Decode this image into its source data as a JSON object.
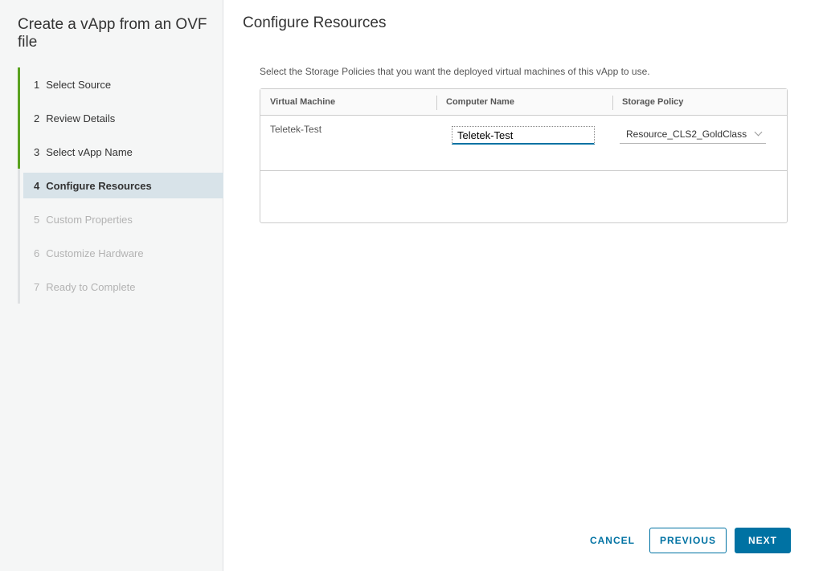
{
  "wizard": {
    "title": "Create a vApp from an OVF file",
    "steps": [
      {
        "num": "1",
        "label": "Select Source",
        "state": "done"
      },
      {
        "num": "2",
        "label": "Review Details",
        "state": "done"
      },
      {
        "num": "3",
        "label": "Select vApp Name",
        "state": "done"
      },
      {
        "num": "4",
        "label": "Configure Resources",
        "state": "active"
      },
      {
        "num": "5",
        "label": "Custom Properties",
        "state": "disabled"
      },
      {
        "num": "6",
        "label": "Customize Hardware",
        "state": "disabled"
      },
      {
        "num": "7",
        "label": "Ready to Complete",
        "state": "disabled"
      }
    ]
  },
  "main": {
    "title": "Configure Resources",
    "instructions": "Select the Storage Policies that you want the deployed virtual machines of this vApp to use.",
    "grid": {
      "columns": [
        "Virtual Machine",
        "Computer Name",
        "Storage Policy"
      ],
      "rows": [
        {
          "vm": "Teletek-Test",
          "computer_name": "Teletek-Test",
          "storage_policy": "Resource_CLS2_GoldClass"
        }
      ]
    }
  },
  "footer": {
    "cancel": "CANCEL",
    "previous": "PREVIOUS",
    "next": "NEXT"
  },
  "colors": {
    "accent": "#0072a3",
    "step_done": "#5aa220",
    "step_active_bg": "#d8e3e9"
  }
}
